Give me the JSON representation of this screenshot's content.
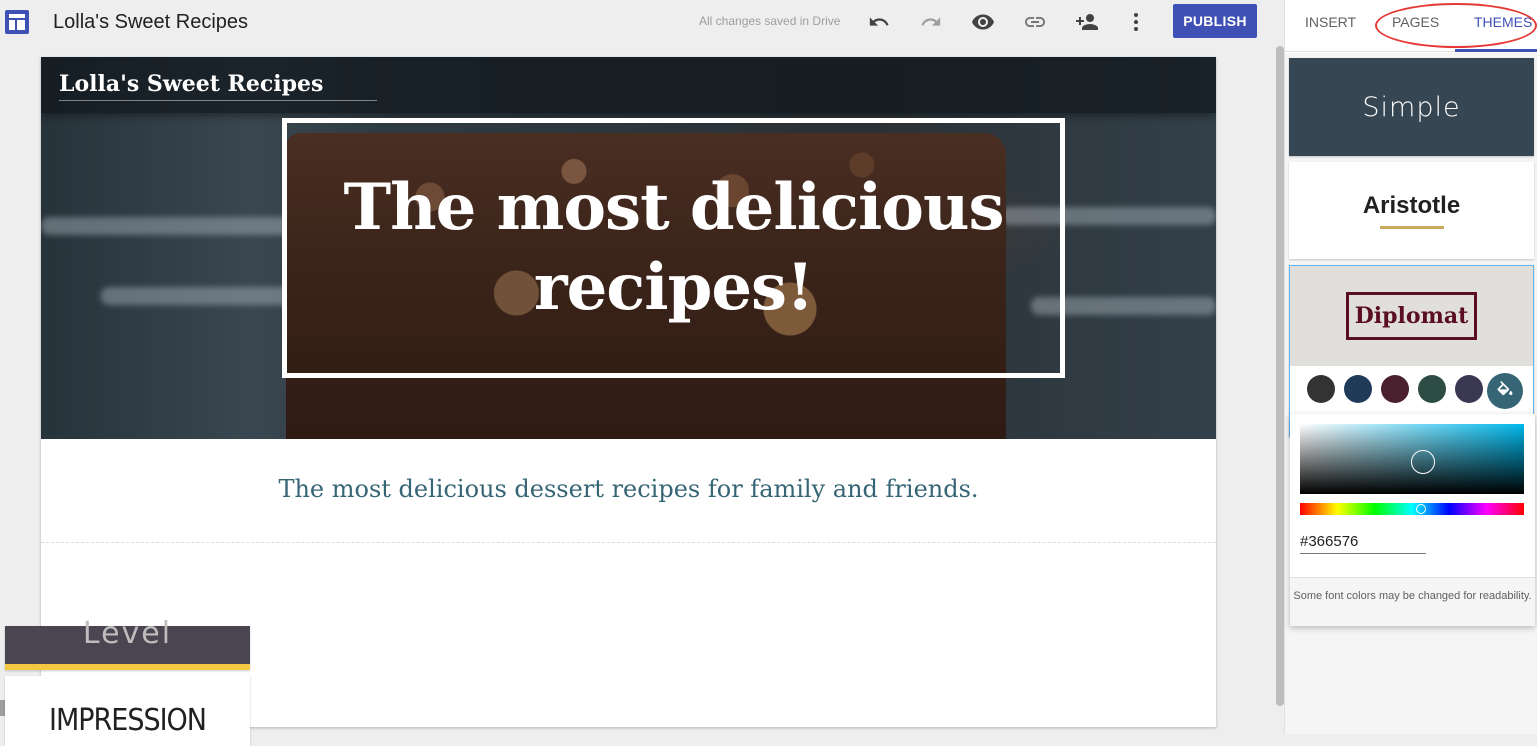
{
  "app": {
    "site_name": "Lolla's Sweet Recipes",
    "save_status": "All changes saved in Drive",
    "publish_label": "PUBLISH"
  },
  "toolbar": {
    "icons": [
      "undo-icon",
      "redo-icon",
      "preview-icon",
      "link-icon",
      "share-icon",
      "more-icon"
    ]
  },
  "page": {
    "header_site_name": "Lolla's Sweet Recipes",
    "hero_title_line1": "The most delicious",
    "hero_title_line2": "recipes!",
    "subtitle": "The most delicious dessert recipes for family and friends.",
    "subtitle_color": "#366576"
  },
  "panel": {
    "tabs": [
      {
        "label": "INSERT",
        "active": false
      },
      {
        "label": "PAGES",
        "active": false
      },
      {
        "label": "THEMES",
        "active": true
      }
    ],
    "themes": {
      "simple": "Simple",
      "aristotle": "Aristotle",
      "diplomat": "Diplomat",
      "fourth_partial": "Level",
      "impression": "IMPRESSION"
    },
    "swatches": [
      "#333333",
      "#203a5a",
      "#4a1f2e",
      "#2c4c44",
      "#3a3852"
    ],
    "selected_color": "#366576",
    "color_picker": {
      "hex_value": "#366576",
      "note": "Some font colors may be changed for readability."
    }
  },
  "colors": {
    "accent": "#3f51b5",
    "annotation": "#e53935"
  }
}
